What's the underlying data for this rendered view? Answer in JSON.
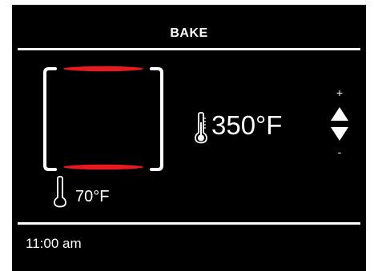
{
  "header": {
    "title": "BAKE"
  },
  "oven": {
    "current_temp": "70°F",
    "heating_element_color": "#e8191f"
  },
  "setpoint": {
    "target_temp": "350°F",
    "increase_label": "+",
    "decrease_label": "-"
  },
  "footer": {
    "time": "11:00 am"
  },
  "colors": {
    "background": "#000000",
    "foreground": "#ffffff",
    "accent": "#e8191f"
  }
}
